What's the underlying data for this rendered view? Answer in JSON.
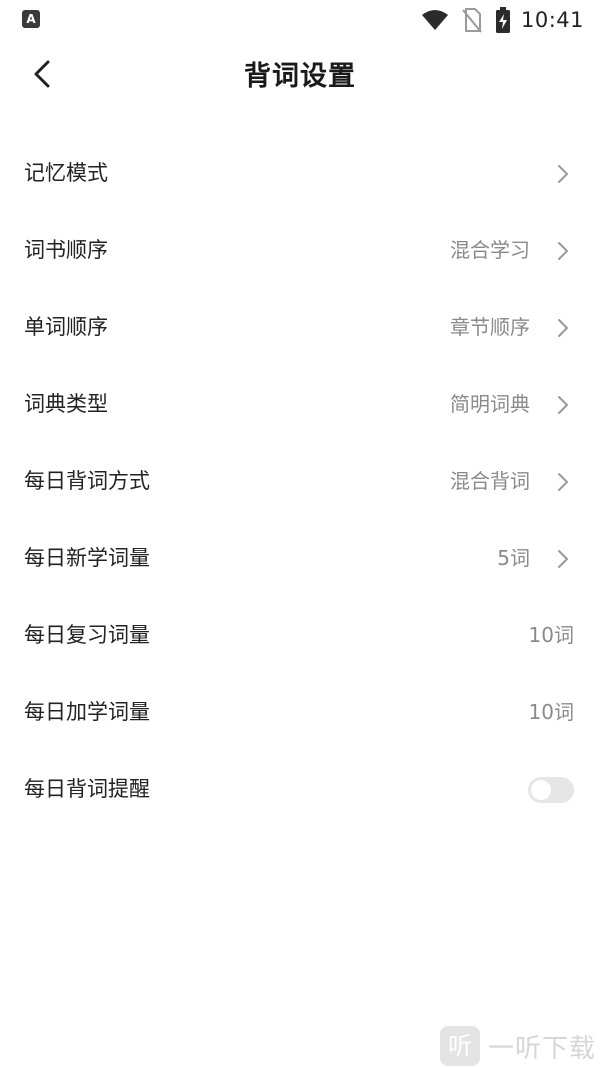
{
  "status_bar": {
    "app_badge": "A",
    "time": "10:41",
    "icons": [
      "wifi-icon",
      "no-sim-icon",
      "battery-charging-icon"
    ]
  },
  "header": {
    "title": "背词设置",
    "back_icon": "chevron-left-icon"
  },
  "settings": [
    {
      "label": "记忆模式",
      "value": "",
      "chevron": true
    },
    {
      "label": "词书顺序",
      "value": "混合学习",
      "chevron": true
    },
    {
      "label": "单词顺序",
      "value": "章节顺序",
      "chevron": true
    },
    {
      "label": "词典类型",
      "value": "简明词典",
      "chevron": true
    },
    {
      "label": "每日背词方式",
      "value": "混合背词",
      "chevron": true
    },
    {
      "label": "每日新学词量",
      "value": "5词",
      "chevron": true
    },
    {
      "label": "每日复习词量",
      "value": "10词",
      "chevron": false
    },
    {
      "label": "每日加学词量",
      "value": "10词",
      "chevron": false
    },
    {
      "label": "每日背词提醒",
      "toggle": false
    }
  ],
  "watermark": {
    "logo_glyph": "听",
    "text": "一听下载"
  },
  "colors": {
    "text_primary": "#222222",
    "text_secondary": "#8a8a8a",
    "toggle_off": "#e6e6e6",
    "chevron": "#9a9a9a"
  }
}
